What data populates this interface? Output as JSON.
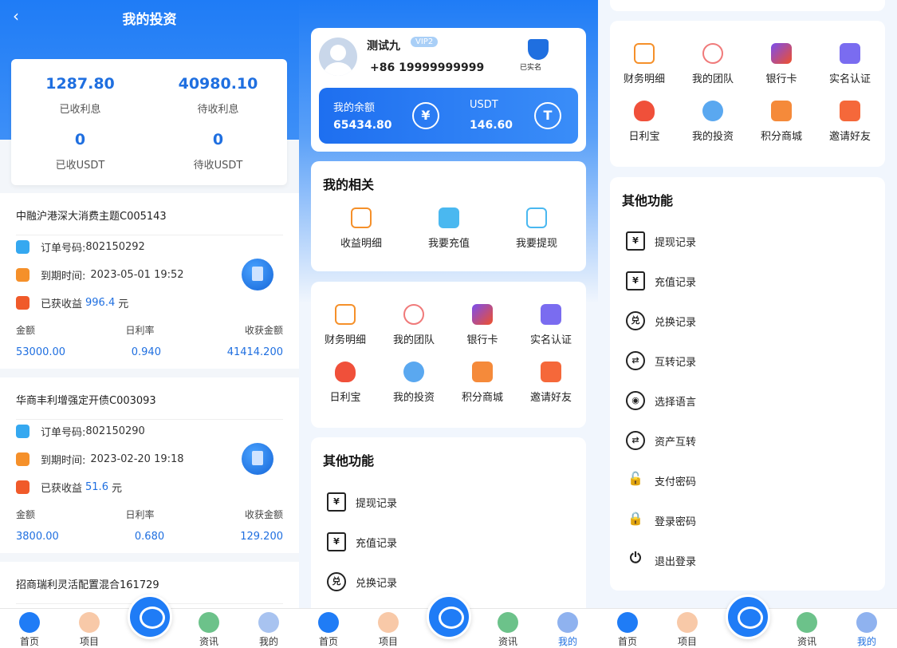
{
  "invest": {
    "title": "我的投资",
    "stats": [
      {
        "value": "1287.80",
        "label": "已收利息"
      },
      {
        "value": "40980.10",
        "label": "待收利息"
      },
      {
        "value": "0",
        "label": "已收USDT"
      },
      {
        "value": "0",
        "label": "待收USDT"
      }
    ],
    "cards": [
      {
        "name": "中融沪港深大消费主题C005143",
        "order_label": "订单号码:",
        "order": "802150292",
        "expire_label": "到期时间:",
        "expire": "2023-05-01 19:52",
        "earned_label": "已获收益",
        "earned": "996.4",
        "unit": "元",
        "col_labels": [
          "金额",
          "日利率",
          "收获金额"
        ],
        "col_values": [
          "53000.00",
          "0.940",
          "41414.200"
        ]
      },
      {
        "name": "华商丰利增强定开债C003093",
        "order_label": "订单号码:",
        "order": "802150290",
        "expire_label": "到期时间:",
        "expire": "2023-02-20 19:18",
        "earned_label": "已获收益",
        "earned": "51.6",
        "unit": "元",
        "col_labels": [
          "金额",
          "日利率",
          "收获金额"
        ],
        "col_values": [
          "3800.00",
          "0.680",
          "129.200"
        ]
      },
      {
        "name": "招商瑞利灵活配置混合161729"
      }
    ]
  },
  "profile": {
    "name": "测试九",
    "vip": "VIP2",
    "phone": "+86 19999999999",
    "verified": "已实名",
    "balance_label": "我的余额",
    "balance": "65434.80",
    "usdt_label": "USDT",
    "usdt": "146.60",
    "coin_symbol": "¥",
    "usdt_symbol": "T"
  },
  "related": {
    "title": "我的相关",
    "items": [
      "收益明细",
      "我要充值",
      "我要提现"
    ]
  },
  "grid": [
    "财务明细",
    "我的团队",
    "银行卡",
    "实名认证",
    "日利宝",
    "我的投资",
    "积分商城",
    "邀请好友"
  ],
  "other": {
    "title": "其他功能",
    "items": [
      "提现记录",
      "充值记录",
      "兑换记录",
      "互转记录",
      "选择语言",
      "资产互转",
      "支付密码",
      "登录密码",
      "退出登录"
    ],
    "icon_glyphs": [
      "¥",
      "¥",
      "兑",
      "⇄",
      "◉",
      "⇄",
      "🔓",
      "🔒",
      "⏻"
    ]
  },
  "tabs": [
    "首页",
    "项目",
    "资讯",
    "我的"
  ],
  "colors": {
    "primary": "#1f7cf6",
    "accent_blue": "#1f6fe0"
  }
}
